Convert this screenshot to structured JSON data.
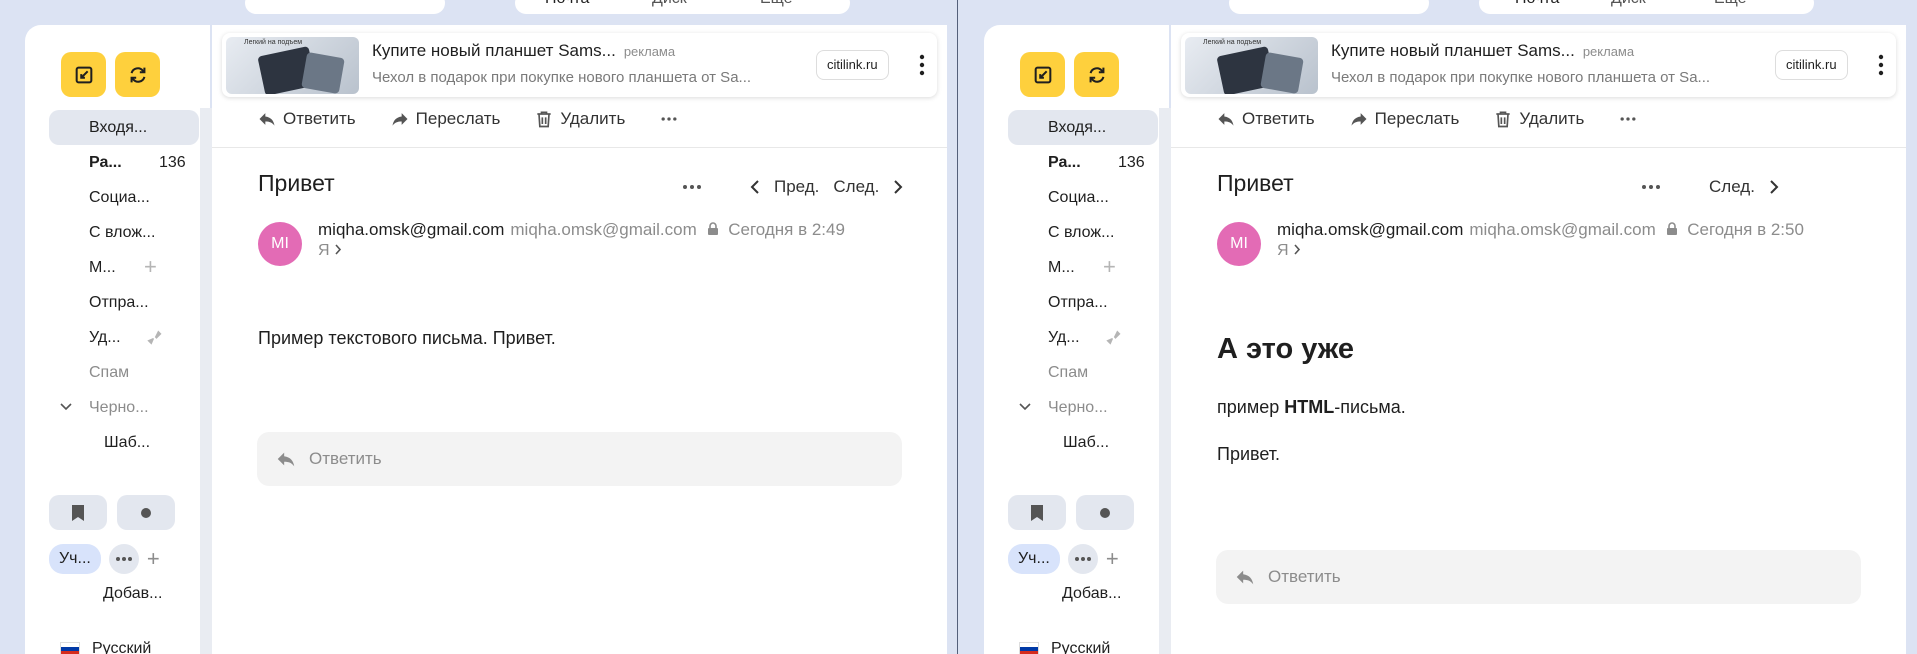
{
  "top_tabs": [
    "Почта",
    "Диск",
    "Еще"
  ],
  "colors": {
    "accent_yellow": "#fed03d",
    "avatar": "#e36bb5",
    "active_folder": "#e3e7ef",
    "tag_chip": "#d8e3fb"
  },
  "sidebar": {
    "compose_icon": "compose-icon",
    "refresh_icon": "refresh-icon",
    "folders": [
      {
        "label": "Входя...",
        "active": true
      },
      {
        "label": "Ра...",
        "count": "136",
        "bold": true
      },
      {
        "label": "Социа..."
      },
      {
        "label": "С влож..."
      },
      {
        "label": "М...",
        "icon": "plus"
      },
      {
        "label": "Отпра..."
      },
      {
        "label": "Уд...",
        "icon": "broom"
      },
      {
        "label": "Спам",
        "muted": true
      },
      {
        "label": "Черно...",
        "muted": true,
        "chevron": true
      },
      {
        "label": "Шаб...",
        "sub": true
      }
    ],
    "tag_chip": "Уч...",
    "add_label": "Добав...",
    "language": "Русский"
  },
  "ad": {
    "image_caption": "Легкий на подъем",
    "title": "Купите новый планшет Sams...",
    "badge": "реклама",
    "description": "Чехол в подарок при покупке нового планшета от Sa...",
    "site": "citilink.ru"
  },
  "toolbar": {
    "reply": "Ответить",
    "forward": "Переслать",
    "delete": "Удалить"
  },
  "left_email": {
    "subject": "Привет",
    "prev": "Пред.",
    "next": "След.",
    "avatar_initials": "MI",
    "sender_name": "miqha.omsk@gmail.com",
    "sender_email": "miqha.omsk@gmail.com",
    "time": "Сегодня в 2:49",
    "to": "Я",
    "body": "Пример текстового письма. Привет.",
    "reply_placeholder": "Ответить"
  },
  "right_email": {
    "subject": "Привет",
    "next": "След.",
    "avatar_initials": "MI",
    "sender_name": "miqha.omsk@gmail.com",
    "sender_email": "miqha.omsk@gmail.com",
    "time": "Сегодня в 2:50",
    "to": "Я",
    "heading": "А это уже",
    "p1_pre": "пример ",
    "p1_bold": "HTML",
    "p1_post": "-письма.",
    "p2": "Привет.",
    "reply_placeholder": "Ответить"
  }
}
